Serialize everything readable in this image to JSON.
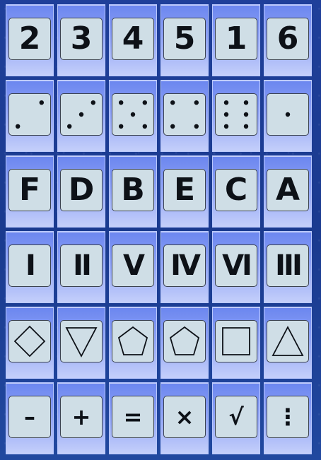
{
  "board": {
    "rows": [
      {
        "kind": "number",
        "cells": [
          "2",
          "3",
          "4",
          "5",
          "1",
          "6"
        ]
      },
      {
        "kind": "dice",
        "cells": [
          2,
          3,
          5,
          4,
          6,
          1
        ]
      },
      {
        "kind": "letter",
        "cells": [
          "F",
          "D",
          "B",
          "E",
          "C",
          "A"
        ]
      },
      {
        "kind": "roman",
        "cells": [
          "I",
          "II",
          "V",
          "IV",
          "VI",
          "III"
        ]
      },
      {
        "kind": "shape",
        "cells": [
          "diamond",
          "triangle-down",
          "pentagon",
          "pentagon",
          "square",
          "triangle-up"
        ]
      },
      {
        "kind": "operator",
        "cells": [
          "–",
          "+",
          "=",
          "×",
          "√",
          "⋮"
        ]
      }
    ]
  }
}
